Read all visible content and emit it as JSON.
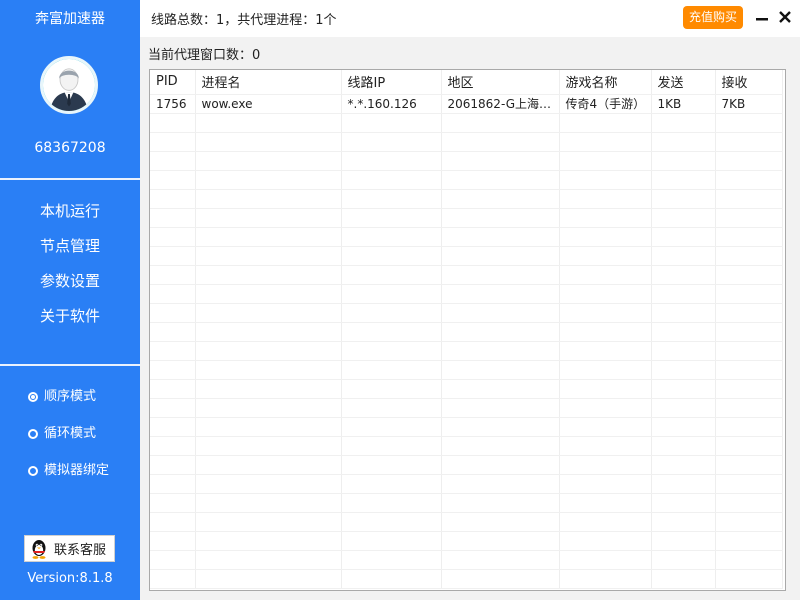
{
  "sidebar": {
    "app_title": "奔富加速器",
    "user_id": "68367208",
    "nav": [
      "本机运行",
      "节点管理",
      "参数设置",
      "关于软件"
    ],
    "modes": [
      {
        "label": "顺序模式",
        "selected": true
      },
      {
        "label": "循环模式",
        "selected": false
      },
      {
        "label": "模拟器绑定",
        "selected": false
      }
    ],
    "contact_label": "联系客服",
    "version": "Version:8.1.8"
  },
  "topbar": {
    "route_summary": "线路总数：1，共代理进程：1个",
    "recharge_label": "充值购买"
  },
  "main": {
    "window_count": "当前代理窗口数：0",
    "table": {
      "columns": [
        "PID",
        "进程名",
        "线路IP",
        "地区",
        "游戏名称",
        "发送",
        "接收"
      ],
      "rows": [
        [
          "1756",
          "wow.exe",
          "*.*.160.126",
          "2061862-G上海市电...",
          "传奇4（手游）",
          "1KB",
          "7KB"
        ]
      ]
    }
  },
  "colors": {
    "sidebar_bg": "#2a7ff5",
    "accent_orange": "#ff8a00"
  }
}
